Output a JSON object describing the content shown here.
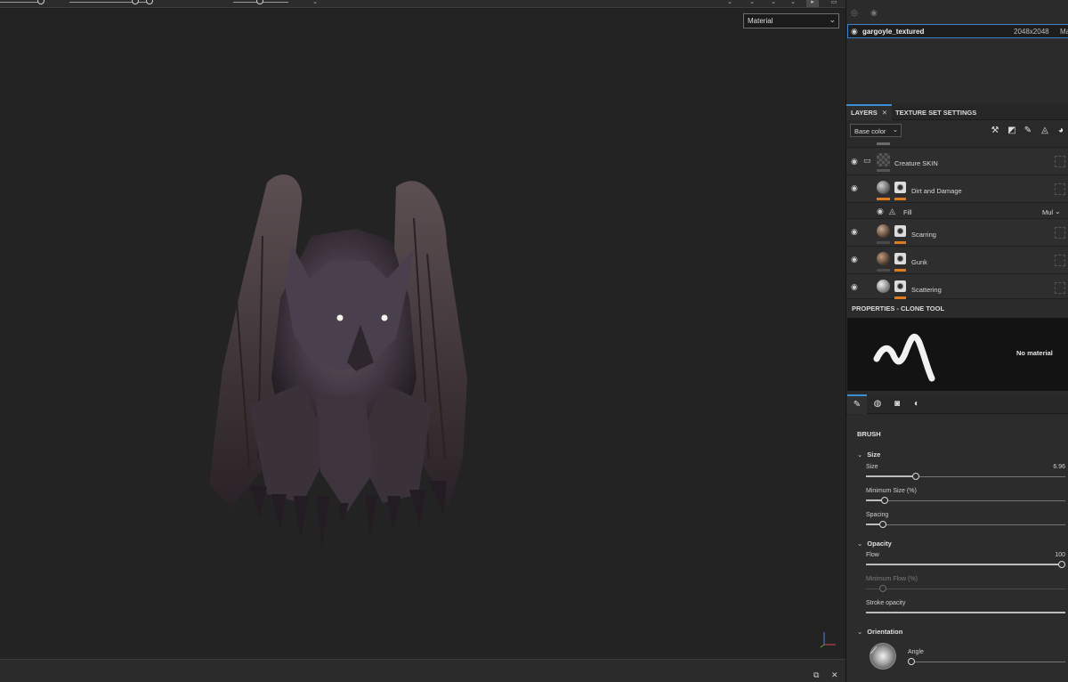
{
  "viewport": {
    "display_mode": "Material"
  },
  "texture_set": {
    "name": "gargoyle_textured",
    "resolution": "2048x2048",
    "material_abbrev": "Ma"
  },
  "layers_panel": {
    "tabs": [
      {
        "label": "LAYERS",
        "close": "✕"
      },
      {
        "label": "TEXTURE SET SETTINGS"
      }
    ],
    "channel": "Base color",
    "layers": [
      {
        "name": "Creature SKIN",
        "type": "folder"
      },
      {
        "name": "Dirt and Damage",
        "type": "fill"
      },
      {
        "name": "Fill",
        "type": "effect",
        "blend": "Mul"
      },
      {
        "name": "Scarring",
        "type": "fill"
      },
      {
        "name": "Gunk",
        "type": "fill"
      },
      {
        "name": "Scattering",
        "type": "fill"
      }
    ]
  },
  "properties": {
    "title": "PROPERTIES - CLONE TOOL",
    "preview_text": "No material",
    "section": "BRUSH",
    "groups": {
      "size": "Size",
      "opacity": "Opacity",
      "orientation": "Orientation"
    },
    "params": {
      "size": {
        "label": "Size",
        "value": "6.96",
        "level": 0.24
      },
      "min_size": {
        "label": "Minimum Size (%)",
        "level": 0.08
      },
      "spacing": {
        "label": "Spacing",
        "level": 0.07
      },
      "flow": {
        "label": "Flow",
        "value": "100",
        "level": 1.0
      },
      "min_flow": {
        "label": "Minimum Flow (%)",
        "level": 0.07
      },
      "stroke_opacity": {
        "label": "Stroke opacity",
        "level": 1.0
      },
      "angle": {
        "label": "Angle",
        "level": 0.0
      }
    }
  },
  "colors": {
    "accent": "#3a8fd6",
    "layer_tag": "#e07a1f"
  }
}
